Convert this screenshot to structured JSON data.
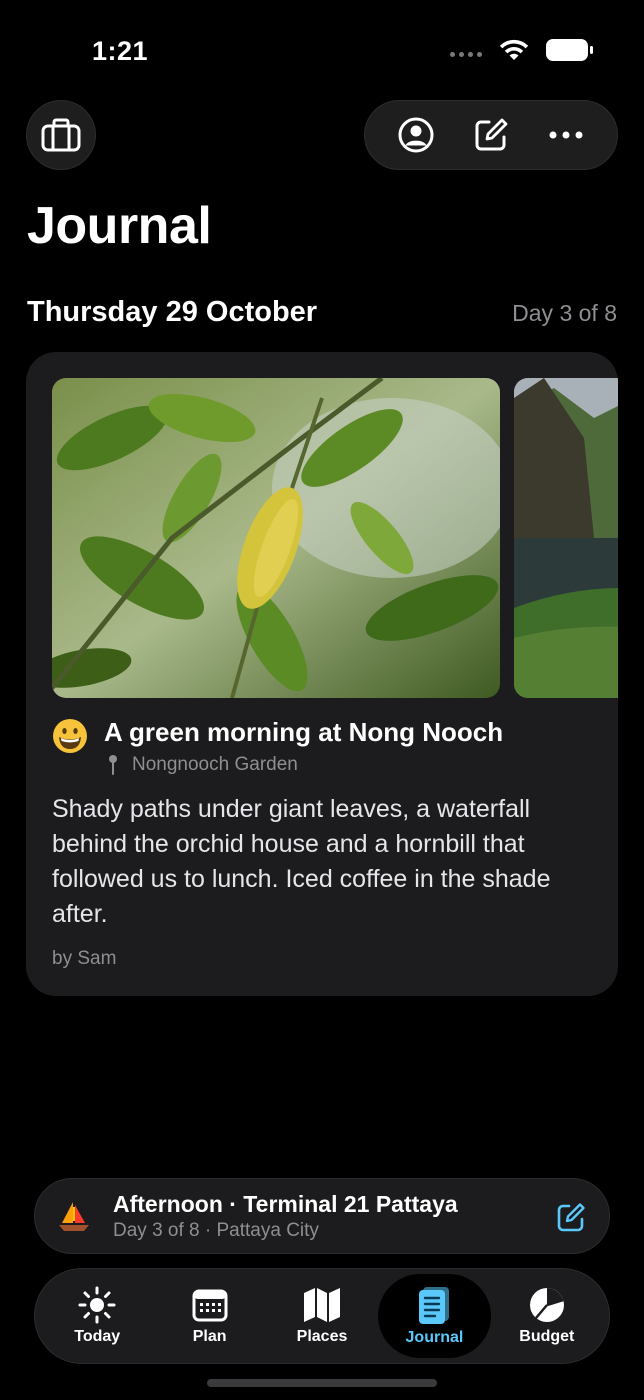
{
  "status": {
    "time": "1:21"
  },
  "header": {
    "title": "Journal"
  },
  "day": {
    "date": "Thursday 29 October",
    "progress": "Day 3 of 8"
  },
  "entry": {
    "title": "A green morning at Nong Nooch",
    "location": "Nongnooch Garden",
    "body": "Shady paths under giant leaves, a waterfall behind the orchid house and a hornbill that followed us to lunch. Iced coffee in the shade after.",
    "author": "by Sam",
    "mood_icon": "grinning-face-emoji",
    "photos": [
      "green-leaves-photo",
      "cliff-lake-photo"
    ]
  },
  "now_bar": {
    "icon": "sailboat-icon",
    "title": "Afternoon · Terminal 21 Pattaya",
    "subtitle": "Day 3 of 8 · Pattaya City"
  },
  "tabs": [
    {
      "label": "Today",
      "icon": "sun-icon"
    },
    {
      "label": "Plan",
      "icon": "calendar-icon"
    },
    {
      "label": "Places",
      "icon": "map-icon"
    },
    {
      "label": "Journal",
      "icon": "journal-icon",
      "active": true
    },
    {
      "label": "Budget",
      "icon": "pie-chart-icon"
    }
  ],
  "colors": {
    "accent": "#5ac8fa",
    "card": "#1c1c1e",
    "secondary_text": "#8e8e93"
  }
}
